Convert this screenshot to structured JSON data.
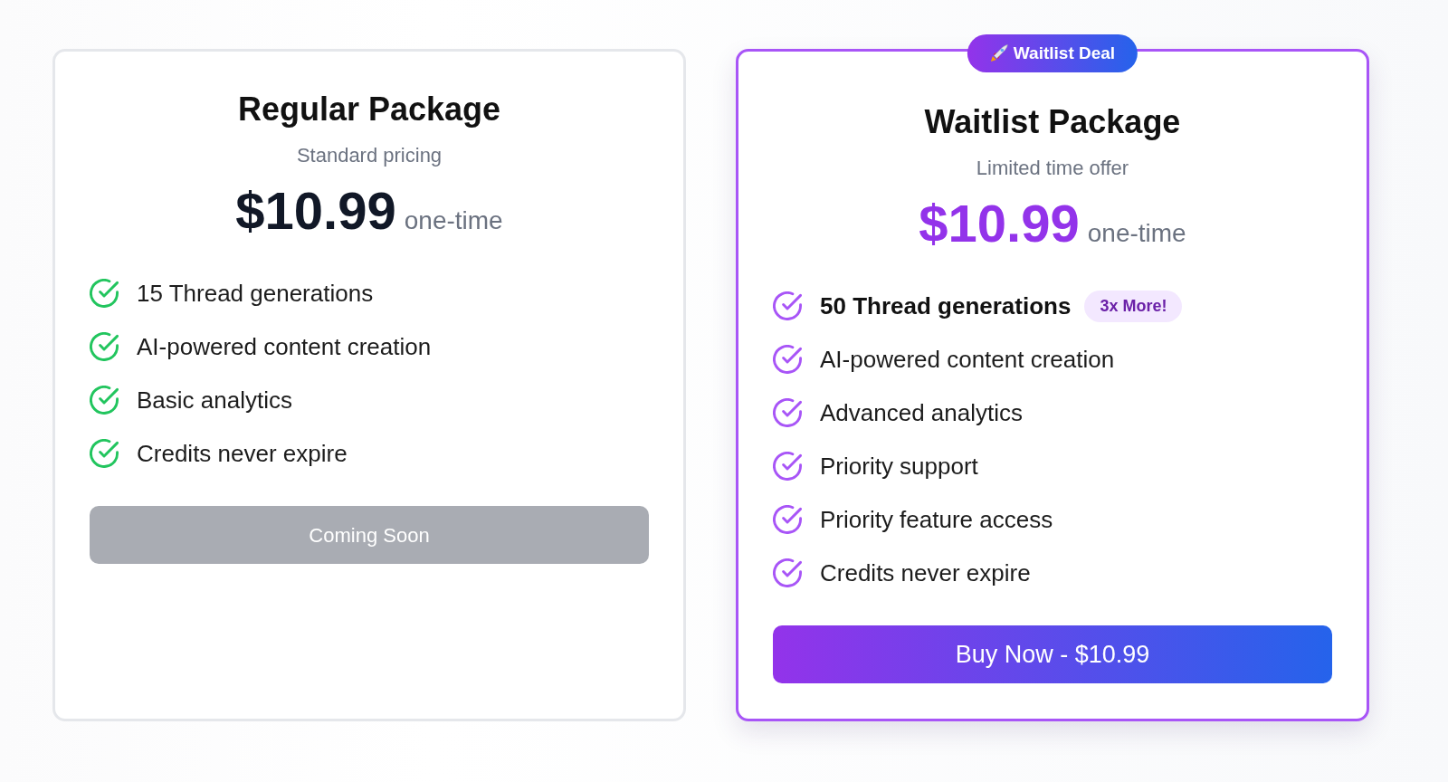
{
  "plans": [
    {
      "featured": false,
      "title": "Regular Package",
      "subtitle": "Standard pricing",
      "price": "$10.99",
      "price_term": "one-time",
      "features": [
        {
          "text": "15 Thread generations",
          "highlight": false
        },
        {
          "text": "AI-powered content creation",
          "highlight": false
        },
        {
          "text": "Basic analytics",
          "highlight": false
        },
        {
          "text": "Credits never expire",
          "highlight": false
        }
      ],
      "button": {
        "label": "Coming Soon",
        "disabled": true
      }
    },
    {
      "featured": true,
      "ribbon": "Waitlist Deal",
      "title": "Waitlist Package",
      "subtitle": "Limited time offer",
      "price": "$10.99",
      "price_term": "one-time",
      "features": [
        {
          "text": "50 Thread generations",
          "highlight": true,
          "tag": "3x More!"
        },
        {
          "text": "AI-powered content creation",
          "highlight": false
        },
        {
          "text": "Advanced analytics",
          "highlight": false
        },
        {
          "text": "Priority support",
          "highlight": false
        },
        {
          "text": "Priority feature access",
          "highlight": false
        },
        {
          "text": "Credits never expire",
          "highlight": false
        }
      ],
      "button": {
        "label": "Buy Now - $10.99",
        "disabled": false
      }
    }
  ]
}
